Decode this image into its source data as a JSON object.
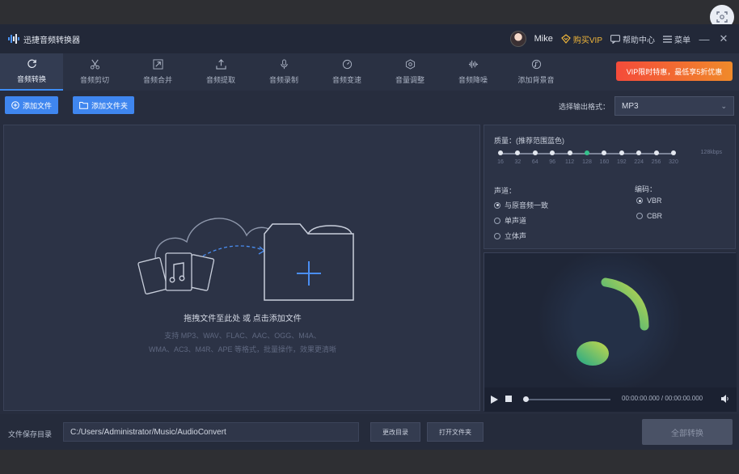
{
  "app": {
    "title": "迅捷音频转换器"
  },
  "titlebar": {
    "user_name": "Mike",
    "vip_label": "购买VIP",
    "help_label": "帮助中心",
    "menu_label": "菜单",
    "minimize": "—",
    "close": "✕"
  },
  "toolbar": {
    "tools": [
      {
        "label": "音频转换",
        "icon": "refresh-icon",
        "active": true
      },
      {
        "label": "音频剪切",
        "icon": "scissors-icon"
      },
      {
        "label": "音频合并",
        "icon": "merge-icon"
      },
      {
        "label": "音频提取",
        "icon": "extract-icon"
      },
      {
        "label": "音频录制",
        "icon": "microphone-icon"
      },
      {
        "label": "音频变速",
        "icon": "speed-icon"
      },
      {
        "label": "音量调整",
        "icon": "volume-adjust-icon"
      },
      {
        "label": "音频降噪",
        "icon": "noise-reduce-icon"
      },
      {
        "label": "添加背景音",
        "icon": "background-music-icon"
      }
    ],
    "promo_text": "VIP限时特惠，最低享5折优惠"
  },
  "actions": {
    "add_file": "添加文件",
    "add_folder": "添加文件夹",
    "format_label": "选择输出格式：",
    "format_value": "MP3"
  },
  "dropzone": {
    "main_text": "拖拽文件至此处 或 点击添加文件",
    "sub_line1": "支持 MP3、WAV、FLAC、AAC、OGG、M4A、",
    "sub_line2": "WMA、AC3、M4R、APE 等格式，批量操作，效果更清晰"
  },
  "settings": {
    "quality_label": "质量：(推荐范围蓝色)",
    "quality_ticks": [
      "16",
      "32",
      "64",
      "96",
      "112",
      "128",
      "160",
      "192",
      "224",
      "256",
      "320"
    ],
    "quality_selected_index": 5,
    "unit": "128kbps",
    "channel_label": "声道：",
    "channels": [
      "与原音频一致",
      "单声道",
      "立体声"
    ],
    "channel_selected": 0,
    "codec_label": "编码：",
    "codecs": [
      "VBR",
      "CBR"
    ],
    "codec_selected": 0
  },
  "player": {
    "time": "00:00:00.000 / 00:00:00.000"
  },
  "bottom": {
    "save_label": "文件保存目录",
    "save_path": "C:/Users/Administrator/Music/AudioConvert",
    "change_dir": "更改目录",
    "open_folder": "打开文件夹",
    "convert_all": "全部转换"
  },
  "colors": {
    "accent": "#3f86ef",
    "promo": "#f44b3a",
    "vip": "#f0b63a",
    "selected_tick": "#35c18b"
  }
}
